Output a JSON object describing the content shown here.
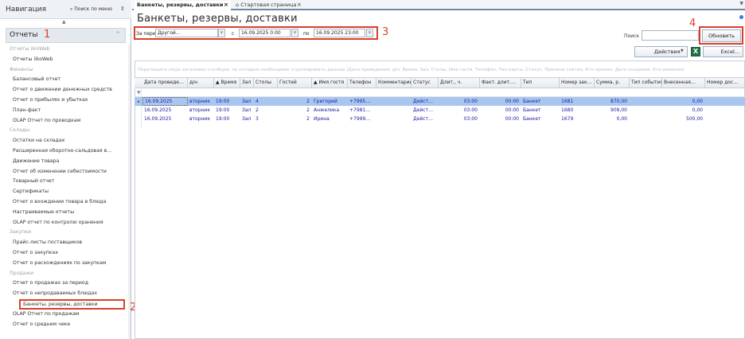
{
  "nav": {
    "title": "Навигация",
    "search_label": "Поиск по меню",
    "pin": "⇕",
    "collapse": "▲",
    "section": "Отчеты",
    "section_chevron": "^",
    "rows": [
      {
        "type": "group",
        "label": "Отчеты iikoWeb"
      },
      {
        "type": "item",
        "label": "Отчеты iikoWeb"
      },
      {
        "type": "group",
        "label": "Финансы"
      },
      {
        "type": "item",
        "label": "Балансовый отчет"
      },
      {
        "type": "item",
        "label": "Отчет о движении денежных средств"
      },
      {
        "type": "item",
        "label": "Отчет о прибылях и убытках"
      },
      {
        "type": "item",
        "label": "План-факт"
      },
      {
        "type": "item",
        "label": "OLAP Отчет по проводкам"
      },
      {
        "type": "group",
        "label": "Склады"
      },
      {
        "type": "item",
        "label": "Остатки на складах"
      },
      {
        "type": "item",
        "label": "Расширенная оборотно-сальдовая в…"
      },
      {
        "type": "item",
        "label": "Движение товара"
      },
      {
        "type": "item",
        "label": "Отчет об изменении себестоимости"
      },
      {
        "type": "item",
        "label": "Товарный отчет"
      },
      {
        "type": "item",
        "label": "Сертификаты"
      },
      {
        "type": "item",
        "label": "Отчет о вхождении товара в блюда"
      },
      {
        "type": "item",
        "label": "Настраиваемые отчеты"
      },
      {
        "type": "item",
        "label": "OLAP отчет по контролю хранения"
      },
      {
        "type": "group",
        "label": "Закупки"
      },
      {
        "type": "item",
        "label": "Прайс-листы поставщиков"
      },
      {
        "type": "item",
        "label": "Отчет о закупках"
      },
      {
        "type": "item",
        "label": "Отчет о расхождениях по закупкам"
      },
      {
        "type": "group",
        "label": "Продажи"
      },
      {
        "type": "item",
        "label": "Отчет о продажах за период"
      },
      {
        "type": "item",
        "label": "Отчет о непродаваемых блюдах"
      },
      {
        "type": "item",
        "label": "Банкеты, резервы, доставки",
        "selected": true
      },
      {
        "type": "item",
        "label": "OLAP Отчет по продажам"
      },
      {
        "type": "item",
        "label": "Отчет о среднем чеке"
      }
    ]
  },
  "annotations": {
    "n1": "1",
    "n2": "2",
    "n3": "3",
    "n4": "4"
  },
  "tabs": [
    {
      "label": "Банкеты, резервы, доставки",
      "active": true,
      "close": "×"
    },
    {
      "label": "⌂ Стартовая страница",
      "active": false,
      "close": "×"
    }
  ],
  "tab_menu": "▼",
  "page_title": "Банкеты, резервы, доставки",
  "period": {
    "label": "За период",
    "value": "Другой...",
    "from_label": "с",
    "from_value": "16.09.2025 0:00",
    "to_label": "по",
    "to_value": "16.09.2025 23:00",
    "drop": "∨"
  },
  "search": {
    "label": "Поиск",
    "value": ""
  },
  "buttons": {
    "refresh": "Обновить",
    "actions": "Действия",
    "actions_chevron": "▼",
    "excel": "Excel...",
    "excel_icon": "X"
  },
  "grid": {
    "group_hint": "Перетащите сюда заголовки столбцов, по которым необходимо сгруппировать данные (Дата проведения, д/н, Время, Зал, Столы, Имя гостя, Телефон, Тип карты, Статус, Причина снятия, Кто принял, Дата создания, Кто изменил)",
    "filter_icon": "▼",
    "row_marker": "▸",
    "columns": [
      "Дата проведе…",
      "д/н",
      "▲ Время",
      "Зал",
      "Столы",
      "Гостей",
      "▲ Имя гостя",
      "Телефон",
      "Комментарии",
      "Статус",
      "Длит., ч.",
      "Факт. длит….",
      "Тип",
      "Номер зак…",
      "Сумма, р.",
      "Тип события",
      "Внесенная…",
      "Номер дос…"
    ],
    "rows": [
      [
        "16.09.2025",
        "вторник",
        "19:00",
        "Зал",
        "4",
        "2",
        "Григорий",
        "+7995…",
        "",
        "Дейст…",
        "03:00",
        "00:00",
        "Банкет",
        "1681",
        "870,00",
        "",
        "0,00",
        ""
      ],
      [
        "16.09.2025",
        "вторник",
        "19:00",
        "Зал",
        "2",
        "2",
        "Анжелика",
        "+7981…",
        "",
        "Дейст…",
        "03:00",
        "00:00",
        "Банкет",
        "1680",
        "909,00",
        "",
        "0,00",
        ""
      ],
      [
        "16.09.2025",
        "вторник",
        "19:00",
        "Зал",
        "3",
        "2",
        "Ирина",
        "+7999…",
        "",
        "Дейст…",
        "03:00",
        "00:00",
        "Банкет",
        "1679",
        "0,00",
        "",
        "500,00",
        ""
      ]
    ]
  },
  "colors": {
    "annotation_red": "#d9402b",
    "selected_row": "#a9c6ef",
    "cell_text": "#1a1aa6"
  }
}
